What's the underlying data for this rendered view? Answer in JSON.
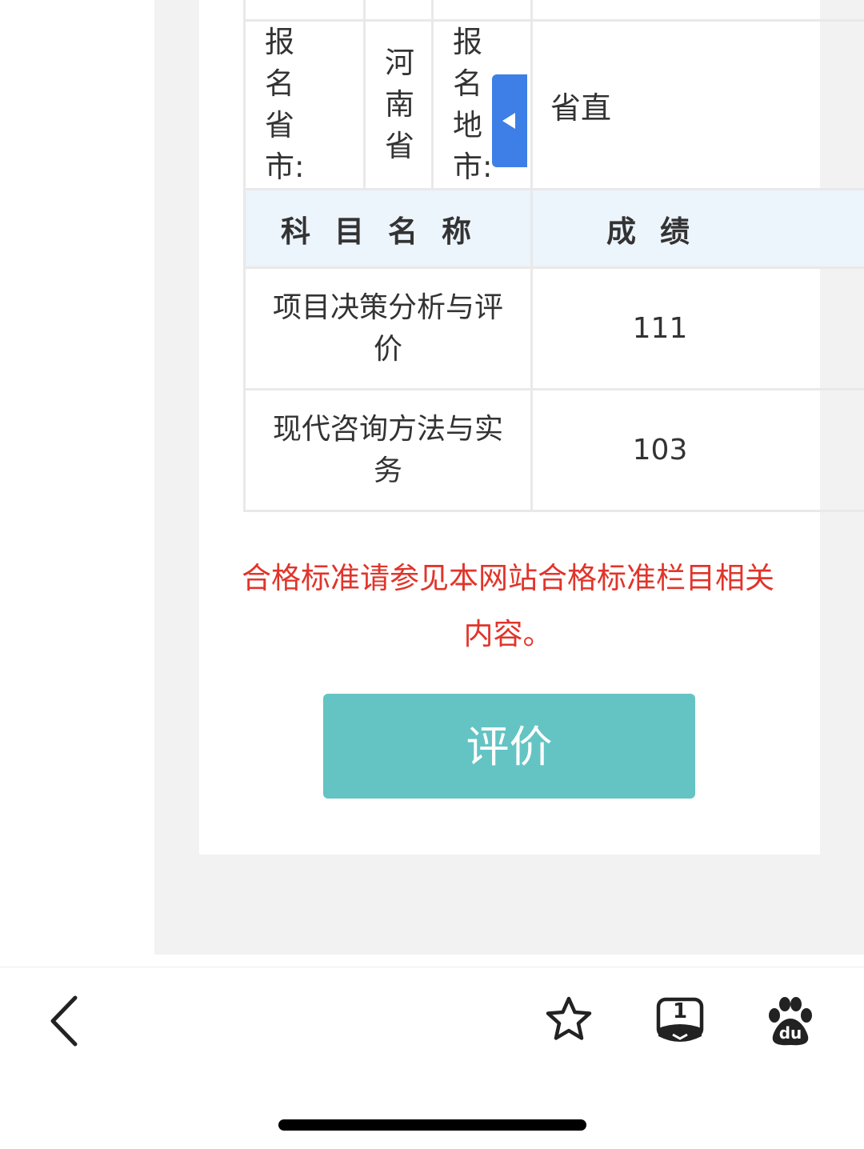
{
  "table": {
    "row_region": {
      "label": "报名省市:",
      "province": "河南省",
      "city_label": "报名地市:",
      "city_value": "省直"
    },
    "header": {
      "subject": "科目名称",
      "score": "成绩"
    },
    "rows": [
      {
        "subject": "项目决策分析与评价",
        "score": "111"
      },
      {
        "subject": "现代咨询方法与实务",
        "score": "103"
      }
    ]
  },
  "notice": "合格标准请参见本网站合格标准栏目相关内容。",
  "rate_button": "评价",
  "toolbar": {
    "tab_count": "1",
    "baidu_label": "du"
  },
  "icons": {
    "back": "back-chevron-icon",
    "favorite": "star-icon",
    "tabs": "tabs-icon",
    "baidu": "baidu-paw-icon",
    "panel_toggle": "collapse-arrow-icon"
  },
  "colors": {
    "notice": "#e0352b",
    "button": "#63c4c3",
    "header_bg": "#ecf4fc",
    "panel_tab": "#3d7fe6"
  }
}
